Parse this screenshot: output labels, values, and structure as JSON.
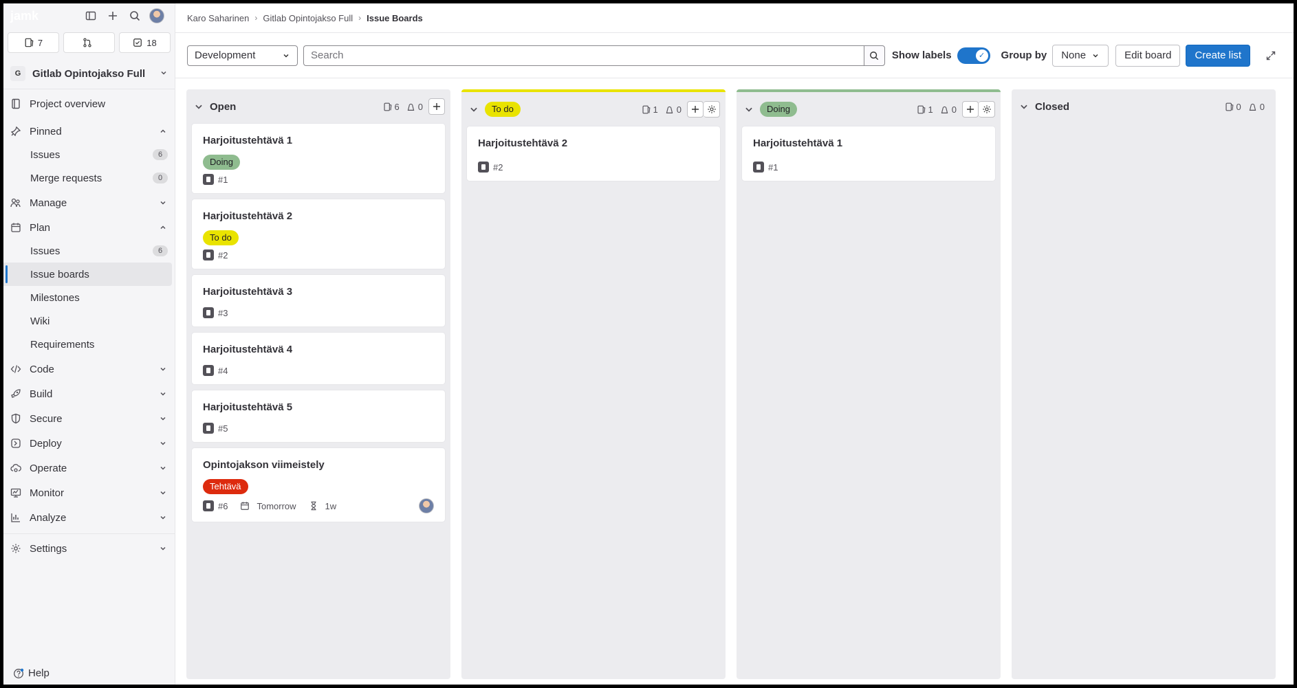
{
  "sidebar": {
    "logo": "jamk",
    "counters": [
      {
        "icon": "issues-icon",
        "value": "7"
      },
      {
        "icon": "merge-request-icon",
        "value": ""
      },
      {
        "icon": "todo-icon",
        "value": "18"
      }
    ],
    "project": {
      "initial": "G",
      "name": "Gitlab Opintojakso Full"
    },
    "overview": "Project overview",
    "pinned": {
      "label": "Pinned",
      "items": [
        {
          "label": "Issues",
          "count": "6"
        },
        {
          "label": "Merge requests",
          "count": "0"
        }
      ]
    },
    "manage": "Manage",
    "plan": {
      "label": "Plan",
      "items": [
        {
          "label": "Issues",
          "count": "6"
        },
        {
          "label": "Issue boards"
        },
        {
          "label": "Milestones"
        },
        {
          "label": "Wiki"
        },
        {
          "label": "Requirements"
        }
      ]
    },
    "sections": [
      "Code",
      "Build",
      "Secure",
      "Deploy",
      "Operate",
      "Monitor",
      "Analyze"
    ],
    "settings": "Settings",
    "help": "Help"
  },
  "breadcrumb": [
    "Karo Saharinen",
    "Gitlab Opintojakso Full",
    "Issue Boards"
  ],
  "toolbar": {
    "board_select": "Development",
    "search_placeholder": "Search",
    "show_labels": "Show labels",
    "group_by": "Group by",
    "group_by_value": "None",
    "edit_board": "Edit board",
    "create_list": "Create list"
  },
  "colors": {
    "todo": "#e9e300",
    "doing": "#8fbc8f",
    "tehtava": "#dd2b0e",
    "primary": "#1f75cb"
  },
  "lists": {
    "open": {
      "title": "Open",
      "issues": "6",
      "weight": "0",
      "cards": [
        {
          "title": "Harjoitustehtävä 1",
          "label": "Doing",
          "ref": "#1"
        },
        {
          "title": "Harjoitustehtävä 2",
          "label": "To do",
          "ref": "#2"
        },
        {
          "title": "Harjoitustehtävä 3",
          "ref": "#3"
        },
        {
          "title": "Harjoitustehtävä 4",
          "ref": "#4"
        },
        {
          "title": "Harjoitustehtävä 5",
          "ref": "#5"
        },
        {
          "title": "Opintojakson viimeistely",
          "label": "Tehtävä",
          "ref": "#6",
          "due": "Tomorrow",
          "estimate": "1w"
        }
      ]
    },
    "todo": {
      "title": "To do",
      "issues": "1",
      "weight": "0",
      "cards": [
        {
          "title": "Harjoitustehtävä 2",
          "ref": "#2"
        }
      ]
    },
    "doing": {
      "title": "Doing",
      "issues": "1",
      "weight": "0",
      "cards": [
        {
          "title": "Harjoitustehtävä 1",
          "ref": "#1"
        }
      ]
    },
    "closed": {
      "title": "Closed",
      "issues": "0",
      "weight": "0"
    }
  }
}
